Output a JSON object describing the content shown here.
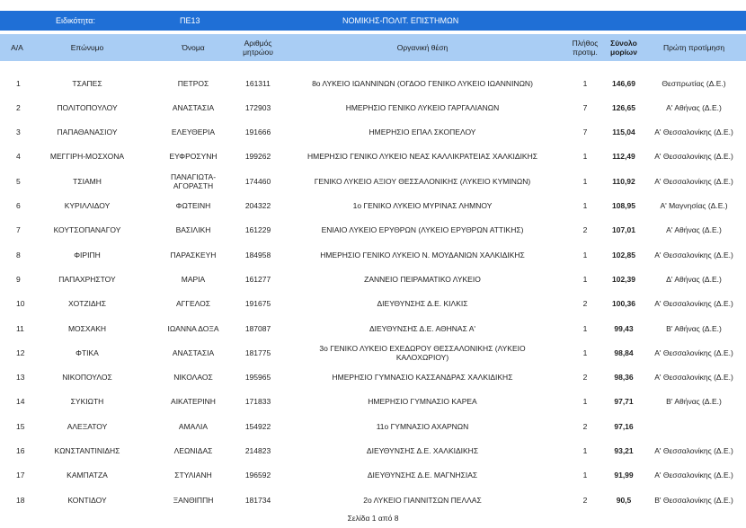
{
  "topbar": {
    "label_specialty": "Ειδικότητα:",
    "code": "ΠΕ13",
    "specialty_name": "ΝΟΜΙΚΗΣ-ΠΟΛΙΤ. ΕΠΙΣΤΗΜΩΝ"
  },
  "headers": {
    "aa": "Α/Α",
    "surname": "Επώνυμο",
    "name": "Όνομα",
    "reg": "Αριθμός\nμητρώου",
    "position": "Οργανική θέση",
    "pref_count": "Πλήθος\nπροτιμ.",
    "total": "Σύνολο\nμορίων",
    "first_pref": "Πρώτη προτίμηση"
  },
  "rows": [
    {
      "aa": "1",
      "surname": "ΤΣΑΠΕΣ",
      "name": "ΠΕΤΡΟΣ",
      "reg": "161311",
      "position": "8ο ΛΥΚΕΙΟ ΙΩΑΝΝΙΝΩΝ (ΟΓΔΟΟ  ΓΕΝΙΚΟ ΛΥΚΕΙΟ ΙΩΑΝΝΙΝΩΝ)",
      "pref": "1",
      "total": "146,69",
      "first": "Θεσπρωτίας (Δ.Ε.)"
    },
    {
      "aa": "2",
      "surname": "ΠΟΛΙΤΟΠΟΥΛΟΥ",
      "name": "ΑΝΑΣΤΑΣΙΑ",
      "reg": "172903",
      "position": "ΗΜΕΡΗΣΙΟ ΓΕΝΙΚΟ ΛΥΚΕΙΟ ΓΑΡΓΑΛΙΑΝΩΝ",
      "pref": "7",
      "total": "126,65",
      "first": "Α' Αθήνας (Δ.Ε.)"
    },
    {
      "aa": "3",
      "surname": "ΠΑΠΑΘΑΝΑΣΙΟΥ",
      "name": "ΕΛΕΥΘΕΡΙΑ",
      "reg": "191666",
      "position": "ΗΜΕΡΗΣΙΟ ΕΠΑΛ ΣΚΟΠΕΛΟΥ",
      "pref": "7",
      "total": "115,04",
      "first": "Α' Θεσσαλονίκης (Δ.Ε.)"
    },
    {
      "aa": "4",
      "surname": "ΜΕΓΓΙΡΗ-ΜΟΣΧΟΝΑ",
      "name": "ΕΥΦΡΟΣΥΝΗ",
      "reg": "199262",
      "position": "ΗΜΕΡΗΣΙΟ ΓΕΝΙΚΟ ΛΥΚΕΙΟ ΝΕΑΣ ΚΑΛΛΙΚΡΑΤΕΙΑΣ ΧΑΛΚΙΔΙΚΗΣ",
      "pref": "1",
      "total": "112,49",
      "first": "Α' Θεσσαλονίκης (Δ.Ε.)"
    },
    {
      "aa": "5",
      "surname": "ΤΣΙΑΜΗ",
      "name": "ΠΑΝΑΓΙΩΤΑ-\nΑΓΟΡΑΣΤΗ",
      "reg": "174460",
      "position": "ΓΕΝΙΚΟ ΛΥΚΕΙΟ ΑΞΙΟΥ ΘΕΣΣΑΛΟΝΙΚΗΣ (ΛΥΚΕΙΟ ΚΥΜΙΝΩΝ)",
      "pref": "1",
      "total": "110,92",
      "first": "Α' Θεσσαλονίκης (Δ.Ε.)"
    },
    {
      "aa": "6",
      "surname": "ΚΥΡΙΛΛΙΔΟΥ",
      "name": "ΦΩΤΕΙΝΗ",
      "reg": "204322",
      "position": "1ο ΓΕΝΙΚΟ ΛΥΚΕΙΟ ΜΥΡΙΝΑΣ ΛΗΜΝΟΥ",
      "pref": "1",
      "total": "108,95",
      "first": "Α' Μαγνησίας (Δ.Ε.)"
    },
    {
      "aa": "7",
      "surname": "ΚΟΥΤΣΟΠΑΝΑΓΟΥ",
      "name": "ΒΑΣΙΛΙΚΗ",
      "reg": "161229",
      "position": "ΕΝΙΑΙΟ ΛΥΚΕΙΟ ΕΡΥΘΡΩΝ (ΛΥΚΕΙΟ ΕΡΥΘΡΩΝ ΑΤΤΙΚΗΣ)",
      "pref": "2",
      "total": "107,01",
      "first": "Α' Αθήνας (Δ.Ε.)"
    },
    {
      "aa": "8",
      "surname": "ΦΙΡΙΠΗ",
      "name": "ΠΑΡΑΣΚΕΥΗ",
      "reg": "184958",
      "position": "ΗΜΕΡΗΣΙΟ ΓΕΝΙΚΟ ΛΥΚΕΙΟ Ν. ΜΟΥΔΑΝΙΩΝ ΧΑΛΚΙΔΙΚΗΣ",
      "pref": "1",
      "total": "102,85",
      "first": "Α' Θεσσαλονίκης (Δ.Ε.)"
    },
    {
      "aa": "9",
      "surname": "ΠΑΠΑΧΡΗΣΤΟΥ",
      "name": "ΜΑΡΙΑ",
      "reg": "161277",
      "position": "ΖΑΝΝΕΙΟ ΠΕΙΡΑΜΑΤΙΚΟ ΛΥΚΕΙΟ",
      "pref": "1",
      "total": "102,39",
      "first": "Δ' Αθήνας (Δ.Ε.)"
    },
    {
      "aa": "10",
      "surname": "ΧΟΤΖΙΔΗΣ",
      "name": "ΑΓΓΕΛΟΣ",
      "reg": "191675",
      "position": "ΔΙΕΥΘΥΝΣΗΣ Δ.Ε. ΚΙΛΚΙΣ",
      "pref": "2",
      "total": "100,36",
      "first": "Α' Θεσσαλονίκης (Δ.Ε.)"
    },
    {
      "aa": "11",
      "surname": "ΜΟΣΧΑΚΗ",
      "name": "ΙΩΑΝΝΑ ΔΟΞΑ",
      "reg": "187087",
      "position": "ΔΙΕΥΘΥΝΣΗΣ Δ.Ε. ΑΘΗΝΑΣ Α'",
      "pref": "1",
      "total": "99,43",
      "first": "Β' Αθήνας (Δ.Ε.)"
    },
    {
      "aa": "12",
      "surname": "ΦΤΙΚΑ",
      "name": "ΑΝΑΣΤΑΣΙΑ",
      "reg": "181775",
      "position": "3ο ΓΕΝΙΚΟ ΛΥΚΕΙΟ ΕΧΕΔΩΡΟΥ ΘΕΣΣΑΛΟΝΙΚΗΣ (ΛΥΚΕΙΟ\nΚΑΛΟΧΩΡΙΟΥ)",
      "pref": "1",
      "total": "98,84",
      "first": "Α' Θεσσαλονίκης (Δ.Ε.)"
    },
    {
      "aa": "13",
      "surname": "ΝΙΚΟΠΟΥΛΟΣ",
      "name": "ΝΙΚΟΛΑΟΣ",
      "reg": "195965",
      "position": "ΗΜΕΡΗΣΙΟ ΓΥΜΝΑΣΙΟ ΚΑΣΣΑΝΔΡΑΣ ΧΑΛΚΙΔΙΚΗΣ",
      "pref": "2",
      "total": "98,36",
      "first": "Α' Θεσσαλονίκης (Δ.Ε.)"
    },
    {
      "aa": "14",
      "surname": "ΣΥΚΙΩΤΗ",
      "name": "ΑΙΚΑΤΕΡΙΝΗ",
      "reg": "171833",
      "position": "ΗΜΕΡΗΣΙΟ ΓΥΜΝΑΣΙΟ ΚΑΡΕΑ",
      "pref": "1",
      "total": "97,71",
      "first": "Β' Αθήνας (Δ.Ε.)"
    },
    {
      "aa": "15",
      "surname": "ΑΛΕΞΑΤΟΥ",
      "name": "ΑΜΑΛΙΑ",
      "reg": "154922",
      "position": "11ο ΓΥΜΝΑΣΙΟ ΑΧΑΡΝΩΝ",
      "pref": "2",
      "total": "97,16",
      "first": ""
    },
    {
      "aa": "16",
      "surname": "ΚΩΝΣΤΑΝΤΙΝΙΔΗΣ",
      "name": "ΛΕΩΝΙΔΑΣ",
      "reg": "214823",
      "position": "ΔΙΕΥΘΥΝΣΗΣ Δ.Ε. ΧΑΛΚΙΔΙΚΗΣ",
      "pref": "1",
      "total": "93,21",
      "first": "Α' Θεσσαλονίκης (Δ.Ε.)"
    },
    {
      "aa": "17",
      "surname": "ΚΑΜΠΑΤΖΑ",
      "name": "ΣΤΥΛΙΑΝΗ",
      "reg": "196592",
      "position": "ΔΙΕΥΘΥΝΣΗΣ Δ.Ε. ΜΑΓΝΗΣΙΑΣ",
      "pref": "1",
      "total": "91,99",
      "first": "Α' Θεσσαλονίκης (Δ.Ε.)"
    },
    {
      "aa": "18",
      "surname": "ΚΟΝΤΙΔΟΥ",
      "name": "ΞΑΝΘΙΠΠΗ",
      "reg": "181734",
      "position": "2ο ΛΥΚΕΙΟ ΓΙΑΝΝΙΤΣΩΝ ΠΕΛΛΑΣ",
      "pref": "2",
      "total": "90,5",
      "first": "Β' Θεσσαλονίκης (Δ.Ε.)"
    }
  ],
  "footer": "Σελίδα 1 από 8"
}
